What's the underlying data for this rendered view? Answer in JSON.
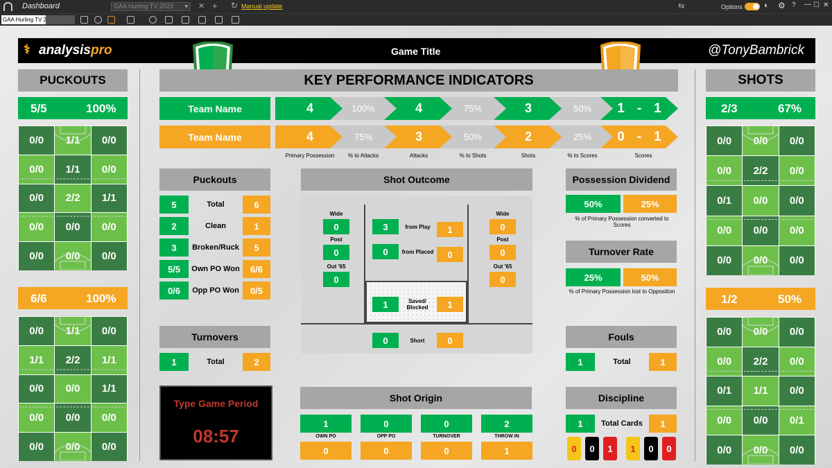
{
  "window": {
    "title": "Dashboard",
    "doc_select": "GAA Hurling TV 2023",
    "link": "Manual update",
    "options": "Options",
    "left_select": "GAA Hurling TV 2"
  },
  "header": {
    "logo_a": "analysis",
    "logo_b": "pro",
    "game_title": "Game Title",
    "handle": "@TonyBambrick"
  },
  "kpi": {
    "title": "KEY PERFORMANCE INDICATORS",
    "team1": {
      "name": "Team Name",
      "vals": [
        "4",
        "100%",
        "4",
        "75%",
        "3",
        "50%"
      ],
      "score_a": "1",
      "score_sep": "-",
      "score_b": "1"
    },
    "team2": {
      "name": "Team Name",
      "vals": [
        "4",
        "75%",
        "3",
        "50%",
        "2",
        "25%"
      ],
      "score_a": "0",
      "score_sep": "-",
      "score_b": "1"
    },
    "labels": [
      "Primary Possession",
      "% to Attacks",
      "Attacks",
      "% to Shots",
      "Shots",
      "% to Scores",
      "Scores"
    ]
  },
  "puckouts_panel": {
    "title": "PUCKOUTS",
    "team1": {
      "ratio": "5/5",
      "pct": "100%",
      "grid": [
        [
          "0/0",
          "1/1",
          "0/0"
        ],
        [
          "0/0",
          "1/1",
          "0/0"
        ],
        [
          "0/0",
          "2/2",
          "1/1"
        ],
        [
          "0/0",
          "0/0",
          "0/0"
        ],
        [
          "0/0",
          "0/0",
          "0/0"
        ]
      ]
    },
    "team2": {
      "ratio": "6/6",
      "pct": "100%",
      "grid": [
        [
          "0/0",
          "1/1",
          "0/0"
        ],
        [
          "1/1",
          "2/2",
          "1/1"
        ],
        [
          "0/0",
          "0/0",
          "1/1"
        ],
        [
          "0/0",
          "0/0",
          "0/0"
        ],
        [
          "0/0",
          "0/0",
          "0/0"
        ]
      ]
    }
  },
  "shots_panel": {
    "title": "SHOTS",
    "team1": {
      "ratio": "2/3",
      "pct": "67%",
      "grid": [
        [
          "0/0",
          "0/0",
          "0/0"
        ],
        [
          "0/0",
          "2/2",
          "0/0"
        ],
        [
          "0/1",
          "0/0",
          "0/0"
        ],
        [
          "0/0",
          "0/0",
          "0/0"
        ],
        [
          "0/0",
          "0/0",
          "0/0"
        ]
      ]
    },
    "team2": {
      "ratio": "1/2",
      "pct": "50%",
      "grid": [
        [
          "0/0",
          "0/0",
          "0/0"
        ],
        [
          "0/0",
          "2/2",
          "0/0"
        ],
        [
          "0/1",
          "1/1",
          "0/0"
        ],
        [
          "0/0",
          "0/0",
          "0/1"
        ],
        [
          "0/0",
          "0/0",
          "0/0"
        ]
      ]
    }
  },
  "puckouts": {
    "title": "Puckouts",
    "rows": [
      {
        "a": "5",
        "label": "Total",
        "b": "6"
      },
      {
        "a": "2",
        "label": "Clean",
        "b": "1"
      },
      {
        "a": "3",
        "label": "Broken/Ruck",
        "b": "5"
      },
      {
        "a": "5/5",
        "label": "Own PO Won",
        "b": "6/6"
      },
      {
        "a": "0/6",
        "label": "Opp PO Won",
        "b": "0/5"
      }
    ]
  },
  "turnovers": {
    "title": "Turnovers",
    "a": "1",
    "label": "Total",
    "b": "2"
  },
  "clock": {
    "period": "Type Game Period",
    "time": "08:57"
  },
  "shot_outcome": {
    "title": "Shot Outcome",
    "left": {
      "wide_l": "Wide",
      "wide": "0",
      "post_l": "Post",
      "post": "0",
      "out_l": "Out '65",
      "out": "0"
    },
    "right": {
      "wide_l": "Wide",
      "wide": "0",
      "post_l": "Post",
      "post": "0",
      "out_l": "Out '65",
      "out": "0"
    },
    "from_play": {
      "a": "3",
      "label": "from Play",
      "b": "1"
    },
    "from_placed": {
      "a": "0",
      "label": "from Placed",
      "b": "0"
    },
    "saved": {
      "a": "1",
      "label": "Saved/ Blocked",
      "b": "1"
    },
    "short": {
      "a": "0",
      "label": "Short",
      "b": "0"
    }
  },
  "shot_origin": {
    "title": "Shot Origin",
    "items": [
      {
        "label": "OWN PO",
        "a": "1",
        "b": "0"
      },
      {
        "label": "OPP PO",
        "a": "0",
        "b": "0"
      },
      {
        "label": "TURNOVER",
        "a": "0",
        "b": "0"
      },
      {
        "label": "THROW IN",
        "a": "2",
        "b": "1"
      }
    ]
  },
  "possession_dividend": {
    "title": "Possession Dividend",
    "a": "50%",
    "b": "25%",
    "desc": "% of Primary Possession converted to Scores"
  },
  "turnover_rate": {
    "title": "Turnover Rate",
    "a": "25%",
    "b": "50%",
    "desc": "% of Primary Possession lost to Opposition"
  },
  "fouls": {
    "title": "Fouls",
    "a": "1",
    "label": "Total",
    "b": "1"
  },
  "discipline": {
    "title": "Discipline",
    "a": "1",
    "label": "Total Cards",
    "b": "1",
    "cards": [
      "0",
      "0",
      "1",
      "1",
      "0",
      "0"
    ]
  },
  "colors": {
    "team1": "#00b050",
    "team2": "#f5a623",
    "dark_green": "#3a7d44",
    "light_green": "#6cc04a"
  }
}
